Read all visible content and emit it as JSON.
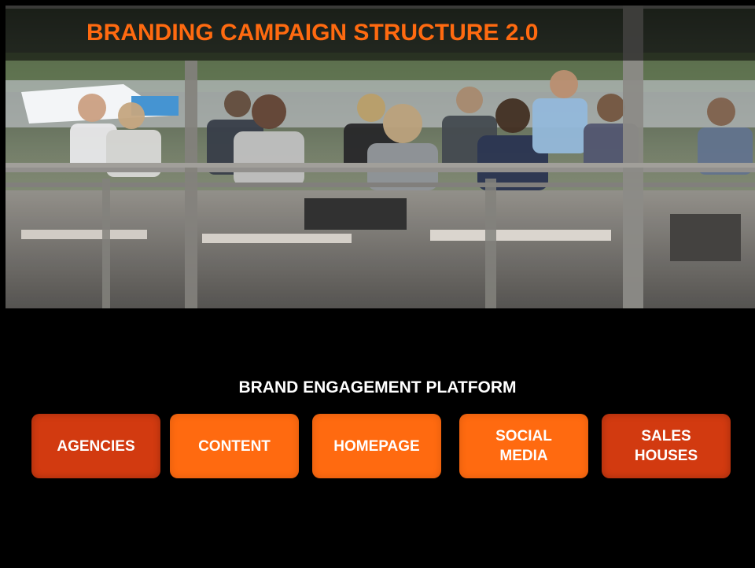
{
  "slide": {
    "title": "BRANDING CAMPAIGN STRUCTURE 2.0",
    "subtitle": "BRAND ENGAGEMENT PLATFORM",
    "tiles": [
      {
        "label": "AGENCIES",
        "color": "#d23a10"
      },
      {
        "label": "CONTENT",
        "color": "#ff6a10"
      },
      {
        "label": "HOMEPAGE",
        "color": "#ff6a10"
      },
      {
        "label": "SOCIAL\nMEDIA",
        "color": "#ff6a10"
      },
      {
        "label": "SALES\nHOUSES",
        "color": "#d23a10"
      }
    ]
  },
  "colors": {
    "accent": "#ff6a10",
    "accent_dark": "#d23a10",
    "background": "#000000"
  }
}
